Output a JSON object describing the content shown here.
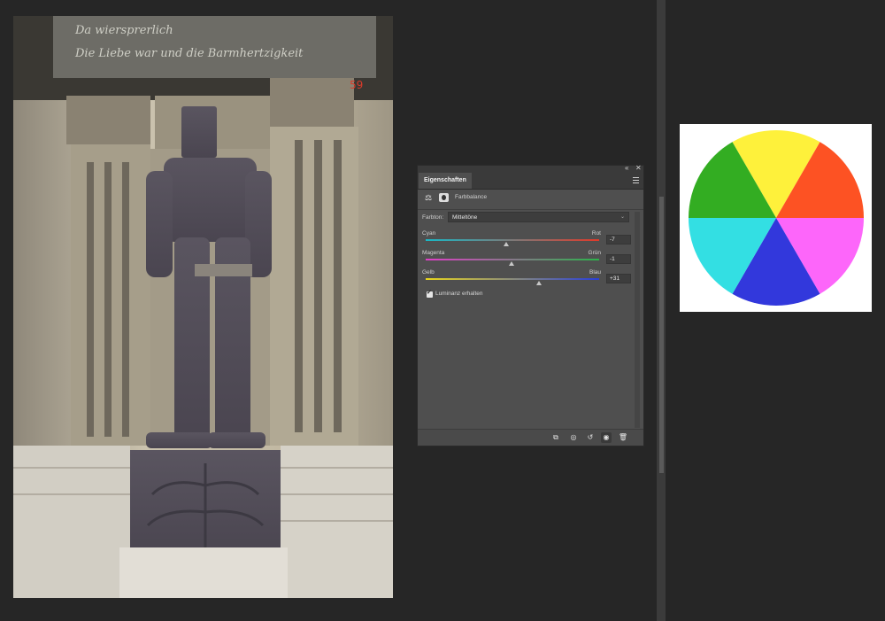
{
  "photo": {
    "inscription_line1": "Da wiersprerlich",
    "inscription_line2": "Die Liebe war und die Barmhertzigkeit"
  },
  "panel": {
    "tab_label": "Eigenschaften",
    "adjustment_title": "Farbbalance",
    "tone": {
      "label": "Farbton:",
      "value": "Mitteltöne"
    },
    "sliders": [
      {
        "left_label": "Cyan",
        "right_label": "Rot",
        "value": "-7",
        "level": -7,
        "gradient": [
          "#19b8c6",
          "#e03a2a"
        ]
      },
      {
        "left_label": "Magenta",
        "right_label": "Grün",
        "value": "-1",
        "level": -1,
        "gradient": [
          "#e03ec8",
          "#2bb34a"
        ]
      },
      {
        "left_label": "Gelb",
        "right_label": "Blau",
        "value": "+31",
        "level": 31,
        "gradient": [
          "#e8d61d",
          "#2a3fd8"
        ]
      }
    ],
    "luminance": {
      "label": "Luminanz erhalten",
      "checked": true
    },
    "footer_icons": [
      "clip-to-layer-icon",
      "view-previous-state-icon",
      "reset-icon",
      "visibility-eye-icon",
      "delete-trash-icon"
    ]
  },
  "wheel": {
    "colors": [
      "#fef13b",
      "#fd5223",
      "#fd66fa",
      "#3238dc",
      "#33dfe3",
      "#33ad22"
    ]
  },
  "colors": {
    "app_bg": "#262626",
    "panel_bg": "#4f4f4f"
  }
}
